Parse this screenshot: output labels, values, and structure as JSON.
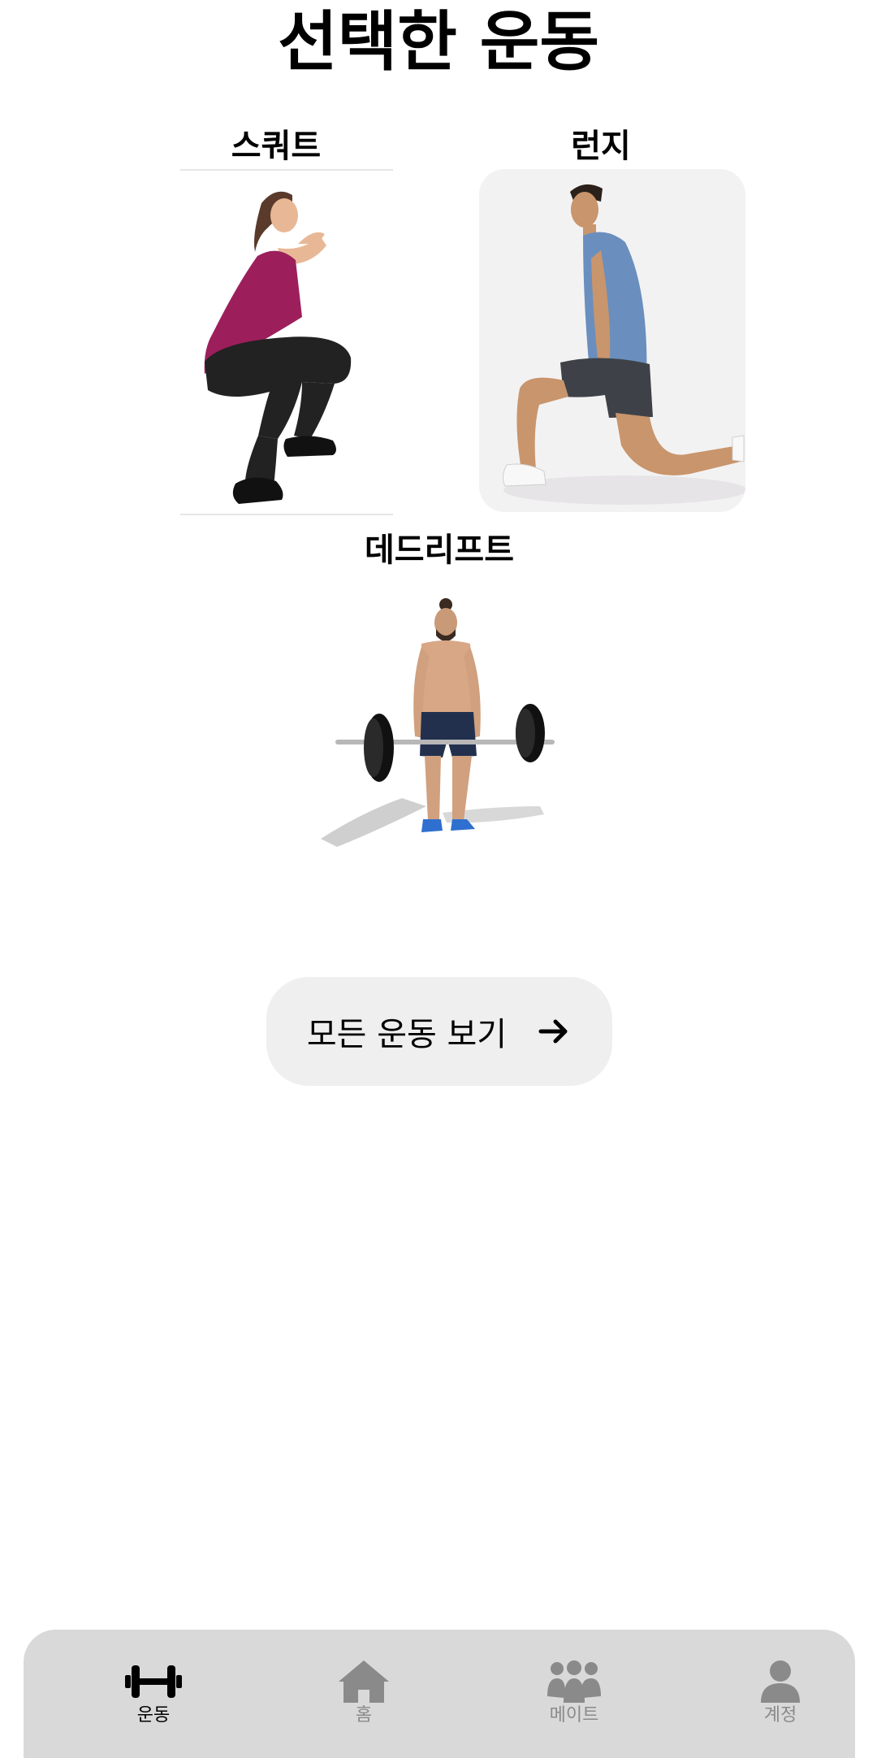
{
  "header": {
    "title": "선택한 운동"
  },
  "exercises": [
    {
      "name": "스쿼트",
      "image": "squat-photo"
    },
    {
      "name": "런지",
      "image": "lunge-photo"
    },
    {
      "name": "데드리프트",
      "image": "deadlift-photo"
    }
  ],
  "actions": {
    "view_all_label": "모든 운동 보기",
    "view_all_icon": "arrow-right-icon"
  },
  "tab_bar": {
    "active_color": "#000000",
    "inactive_color": "#8a8a8a",
    "background": "#d9d9d9",
    "tabs": [
      {
        "label": "운동",
        "icon": "dumbbell-icon",
        "active": true
      },
      {
        "label": "홈",
        "icon": "home-icon",
        "active": false
      },
      {
        "label": "메이트",
        "icon": "group-icon",
        "active": false
      },
      {
        "label": "계정",
        "icon": "person-icon",
        "active": false
      }
    ]
  }
}
